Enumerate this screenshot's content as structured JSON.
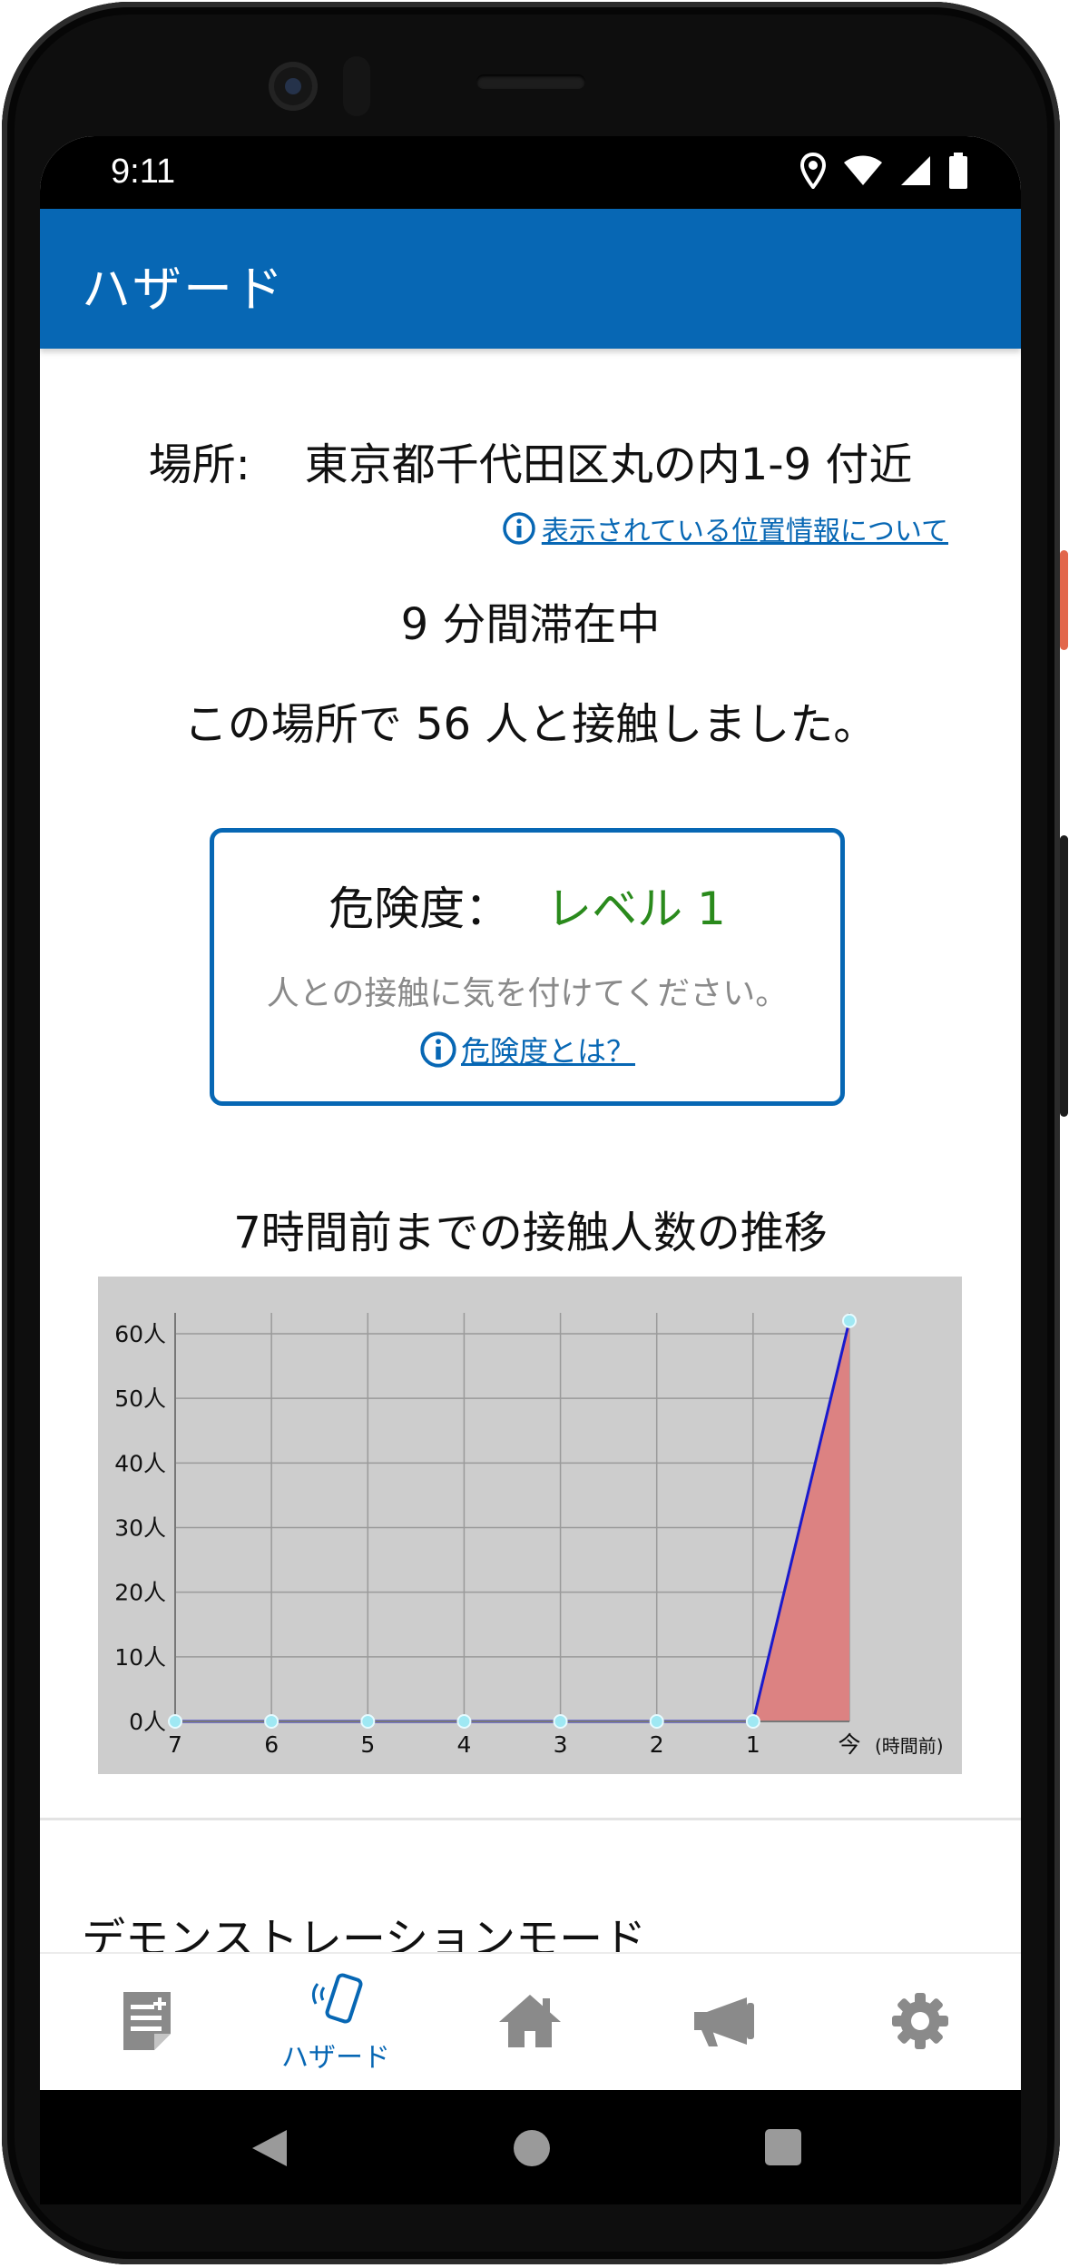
{
  "status_bar": {
    "time": "9:11",
    "icons": [
      "location-icon",
      "wifi-icon",
      "signal-icon",
      "battery-icon"
    ]
  },
  "app_bar": {
    "title": "ハザード"
  },
  "location": {
    "label": "場所:",
    "address": "東京都千代田区丸の内1-9 付近",
    "info_link": "表示されている位置情報について"
  },
  "stay": {
    "text": "9 分間滞在中"
  },
  "contact": {
    "text": "この場所で 56 人と接触しました。"
  },
  "risk": {
    "label": "危険度：",
    "level": "レベル 1",
    "level_color": "#2a8a1c",
    "message": "人との接触に気を付けてください。",
    "info_link": "危険度とは？"
  },
  "chart_title": "7時間前までの接触人数の推移",
  "chart_data": {
    "type": "area",
    "title": "7時間前までの接触人数の推移",
    "x": [
      "7",
      "6",
      "5",
      "4",
      "3",
      "2",
      "1",
      "今"
    ],
    "x_unit_label": "(時間前)",
    "values": [
      0,
      0,
      0,
      0,
      0,
      0,
      0,
      62
    ],
    "ylim": [
      0,
      60
    ],
    "yticks": [
      "0人",
      "10人",
      "20人",
      "30人",
      "40人",
      "50人",
      "60人"
    ],
    "ytick_values": [
      0,
      10,
      20,
      30,
      40,
      50,
      60
    ],
    "grid": true,
    "line_color": "#1a1acc",
    "fill_color": "#dc8282",
    "marker_color": "#9fe8f3",
    "background": "#cdcdcd"
  },
  "demo_section": {
    "title": "デモンストレーションモード"
  },
  "bottom_nav": {
    "items": [
      {
        "icon": "document-icon",
        "label": ""
      },
      {
        "icon": "phone-hazard-icon",
        "label": "ハザード",
        "active": true
      },
      {
        "icon": "home-icon",
        "label": ""
      },
      {
        "icon": "megaphone-icon",
        "label": ""
      },
      {
        "icon": "gear-icon",
        "label": ""
      }
    ],
    "active_color": "#0767b4",
    "inactive_color": "#8a8a8a"
  },
  "system_nav": {
    "icons": [
      "back-icon",
      "home-circle-icon",
      "recents-icon"
    ]
  },
  "colors": {
    "primary": "#0767b4",
    "status_bar": "#000000",
    "frame": "#0e0e0e"
  }
}
